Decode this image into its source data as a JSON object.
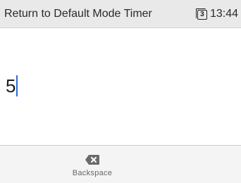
{
  "header": {
    "title": "Return to Default Mode Timer",
    "line_number": "3",
    "time": "13:44"
  },
  "input": {
    "value": "5"
  },
  "softkeys": {
    "backspace": {
      "icon": "backspace-icon",
      "label": "Backspace"
    }
  },
  "colors": {
    "header_bg": "#e9e9e9",
    "caret": "#2f6bd8",
    "softkey_bar_bg": "#f4f4f4"
  }
}
